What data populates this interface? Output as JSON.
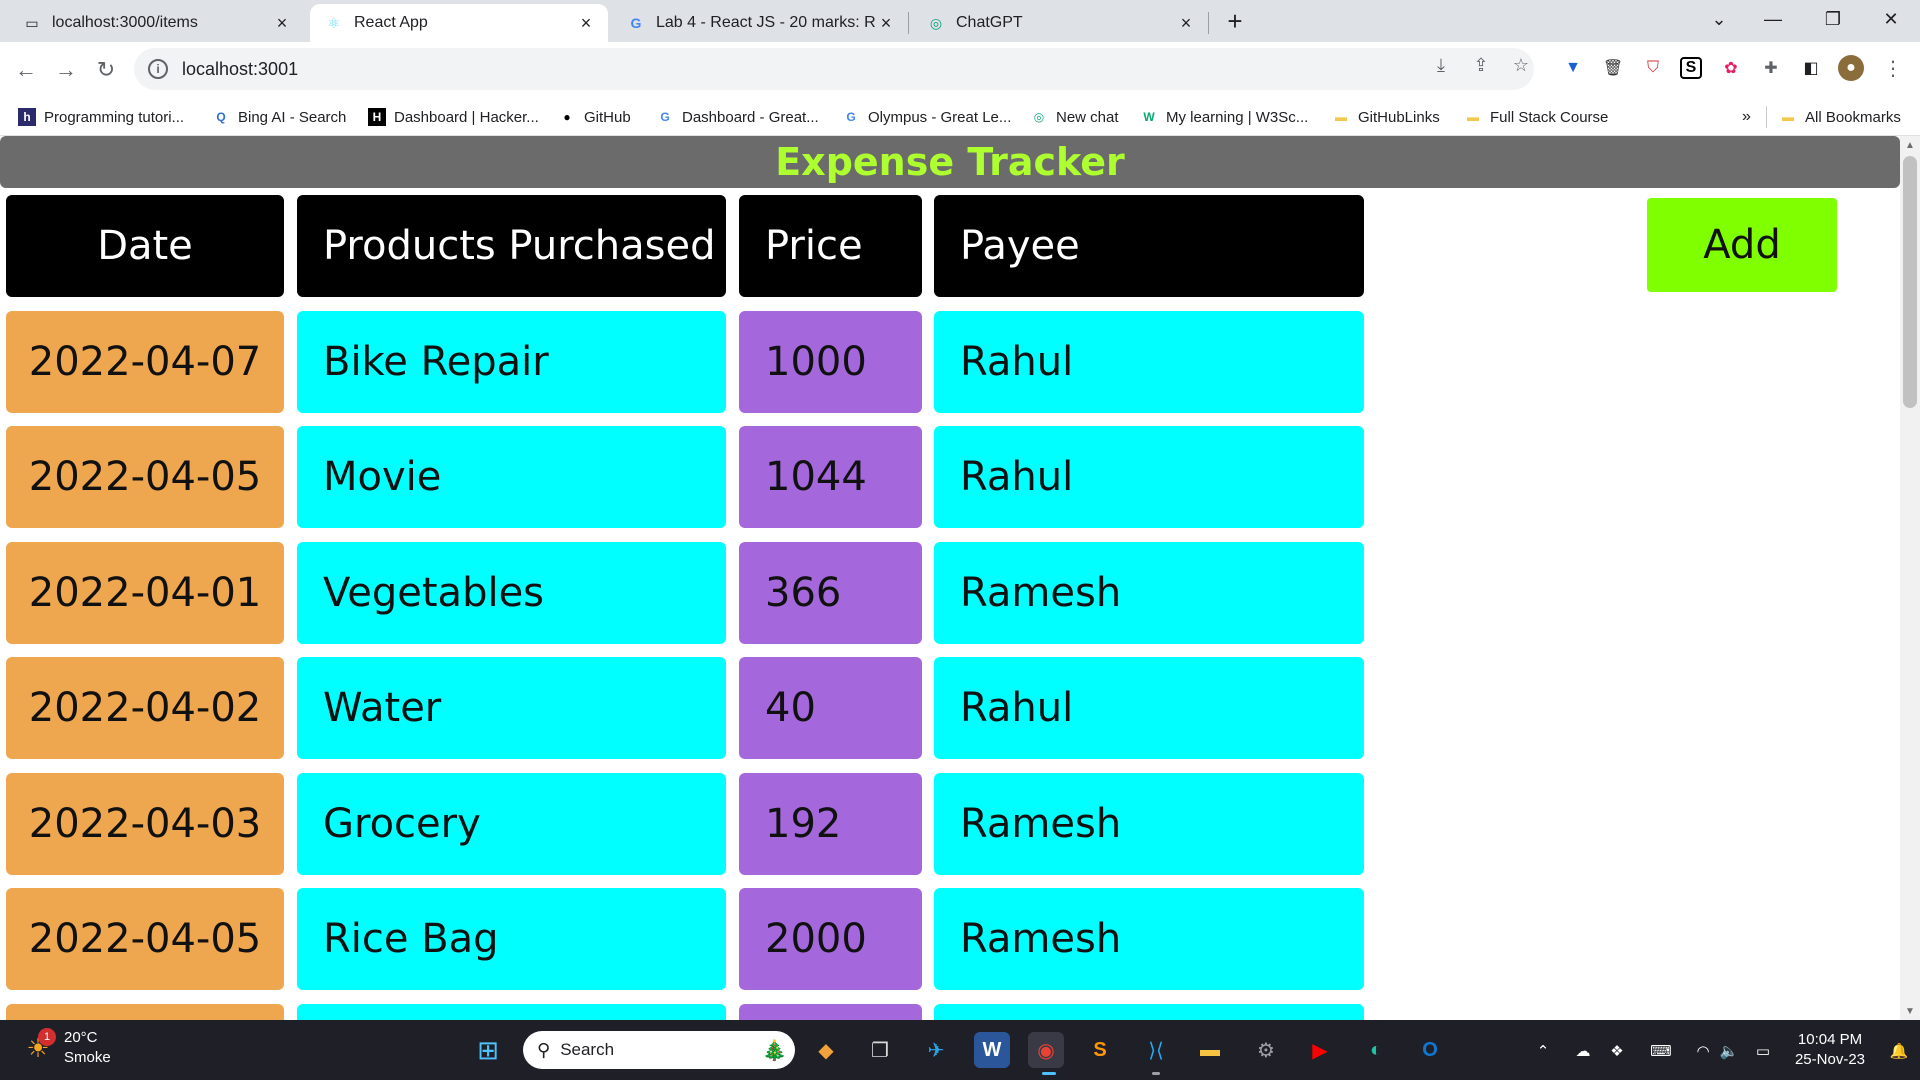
{
  "browser": {
    "tabs": [
      {
        "title": "localhost:3000/items",
        "icon": "localhost-icon"
      },
      {
        "title": "React App",
        "icon": "react-icon",
        "active": true
      },
      {
        "title": "Lab 4 - React JS - 20 marks: Reac",
        "icon": "google-icon"
      },
      {
        "title": "ChatGPT",
        "icon": "chatgpt-icon"
      }
    ],
    "url": "localhost:3001",
    "bookmarks": [
      {
        "label": "Programming tutori...",
        "icon_text": "h",
        "icon_color": "#2b2b6b"
      },
      {
        "label": "Bing AI - Search",
        "icon_text": "Q",
        "icon_color": "#2f6fd6"
      },
      {
        "label": "Dashboard | Hacker...",
        "icon_text": "H",
        "icon_color": "#000000"
      },
      {
        "label": "GitHub",
        "icon_text": "●",
        "icon_color": "#000000"
      },
      {
        "label": "Dashboard - Great...",
        "icon_text": "G",
        "icon_color": "#4285f4"
      },
      {
        "label": "Olympus - Great Le...",
        "icon_text": "G",
        "icon_color": "#4285f4"
      },
      {
        "label": "New chat",
        "icon_text": "◎",
        "icon_color": "#10a37f"
      },
      {
        "label": "My learning | W3Sc...",
        "icon_text": "W",
        "icon_color": "#04aa6d"
      },
      {
        "label": "GitHubLinks",
        "icon_text": "▬",
        "icon_color": "#f2c94c"
      },
      {
        "label": "Full Stack Course",
        "icon_text": "▬",
        "icon_color": "#f2c94c"
      }
    ],
    "overflow_label": "»",
    "all_bookmarks": "All Bookmarks"
  },
  "page": {
    "title": "Expense Tracker",
    "headers": {
      "date": "Date",
      "product": "Products Purchased",
      "price": "Price",
      "payee": "Payee"
    },
    "add_label": "Add",
    "rows": [
      {
        "date": "2022-04-07",
        "product": "Bike Repair",
        "price": "1000",
        "payee": "Rahul"
      },
      {
        "date": "2022-04-05",
        "product": "Movie",
        "price": "1044",
        "payee": "Rahul"
      },
      {
        "date": "2022-04-01",
        "product": "Vegetables",
        "price": "366",
        "payee": "Ramesh"
      },
      {
        "date": "2022-04-02",
        "product": "Water",
        "price": "40",
        "payee": "Rahul"
      },
      {
        "date": "2022-04-03",
        "product": "Grocery",
        "price": "192",
        "payee": "Ramesh"
      },
      {
        "date": "2022-04-05",
        "product": "Rice Bag",
        "price": "2000",
        "payee": "Ramesh"
      },
      {
        "date": "",
        "product": "",
        "price": "",
        "payee": ""
      }
    ],
    "colors": {
      "header_bar": "#6b6b6b",
      "title": "#adff2f",
      "date_cell": "#efa74f",
      "product_cell": "#00ffff",
      "price_cell": "#a568dc",
      "payee_cell": "#00ffff",
      "add_button": "#7fff00"
    }
  },
  "taskbar": {
    "weather": {
      "temp": "20°C",
      "desc": "Smoke",
      "badge": "1"
    },
    "search_placeholder": "Search",
    "time": "10:04 PM",
    "date": "25-Nov-23"
  }
}
